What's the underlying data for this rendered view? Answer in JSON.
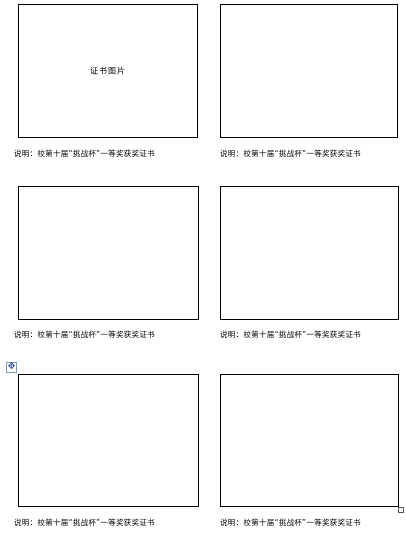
{
  "table": {
    "cells": [
      {
        "placeholder": "证书图片",
        "caption": "说明：校第十届“挑战杯”一等奖获奖证书"
      },
      {
        "placeholder": "",
        "caption": "说明：校第十届“挑战杯”一等奖获奖证书"
      },
      {
        "placeholder": "",
        "caption": "说明：校第十届“挑战杯”一等奖获奖证书"
      },
      {
        "placeholder": "",
        "caption": "说明：校第十届“挑战杯”一等奖获奖证书"
      },
      {
        "placeholder": "",
        "caption": "说明：校第十届“挑战杯”一等奖获奖证书"
      },
      {
        "placeholder": "",
        "caption": "说明：校第十届“挑战杯”一等奖获奖证书"
      }
    ]
  },
  "icons": {
    "move_handle": "move-cross-icon",
    "resize_handle": "resize-square-icon"
  }
}
